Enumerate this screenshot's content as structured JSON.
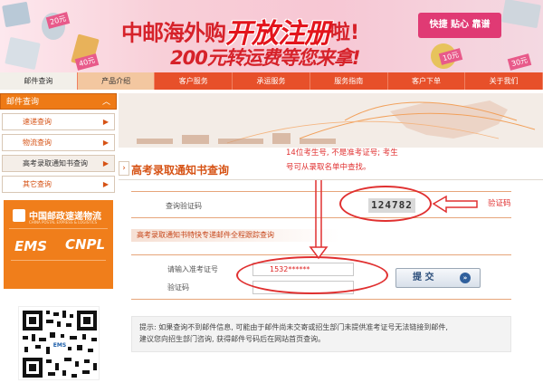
{
  "banner": {
    "line1_part1": "中邮海外购",
    "line1_part2": "开放注册",
    "line1_part3": "啦!",
    "line2": "200元转运费等您来拿!",
    "slogan": "快捷 贴心 靠谱",
    "tags": [
      "20元",
      "40元",
      "10元",
      "30元"
    ]
  },
  "nav": {
    "items": [
      "邮件查询",
      "产品介绍",
      "客户服务",
      "承运服务",
      "服务指南",
      "客户下单",
      "关于我们"
    ]
  },
  "sidebar": {
    "header": "邮件查询",
    "items": [
      {
        "label": "速递查询"
      },
      {
        "label": "物流查询"
      },
      {
        "label": "高考录取通知书查询"
      },
      {
        "label": "其它查询"
      }
    ],
    "logo": {
      "cn": "中国邮政速递物流",
      "en": "CHINA POSTAL EXPRESS & LOGISTICS",
      "ems": "EMS",
      "cnpl": "CNPL"
    }
  },
  "main": {
    "heading": "高考录取通知书查询",
    "verify_label": "查询验证码",
    "captcha": "124782",
    "track_title": "高考录取通知书特快专递邮件全程跟踪查询",
    "exam_label": "请输入准考证号",
    "exam_value": "1532******",
    "code_label": "验证码",
    "submit": "提 交",
    "notice_line1": "提示: 如果查询不到邮件信息, 可能由于邮件尚未交寄或招生部门未提供准考证号无法链接到邮件,",
    "notice_line2": "建议您向招生部门咨询, 获得邮件号码后在网站首页查询。"
  },
  "annotations": {
    "note_line1": "14位考生号, 不是准考证号; 考生",
    "note_line2": "号可从录取名单中查找。",
    "verify_note": "验证码",
    "color": "#e03030"
  }
}
